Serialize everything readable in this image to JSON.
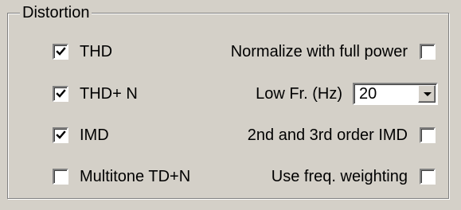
{
  "group": {
    "title": "Distortion"
  },
  "left_options": [
    {
      "label": "THD",
      "checked": true
    },
    {
      "label": "THD+ N",
      "checked": true
    },
    {
      "label": "IMD",
      "checked": true
    },
    {
      "label": "Multitone TD+N",
      "checked": false
    }
  ],
  "right_options": {
    "normalize": {
      "label": "Normalize with full power",
      "checked": false
    },
    "low_freq": {
      "label": "Low Fr. (Hz)",
      "value": "20"
    },
    "imd_order": {
      "label": "2nd and 3rd order IMD",
      "checked": false
    },
    "freq_weighting": {
      "label": "Use freq. weighting",
      "checked": false
    }
  }
}
